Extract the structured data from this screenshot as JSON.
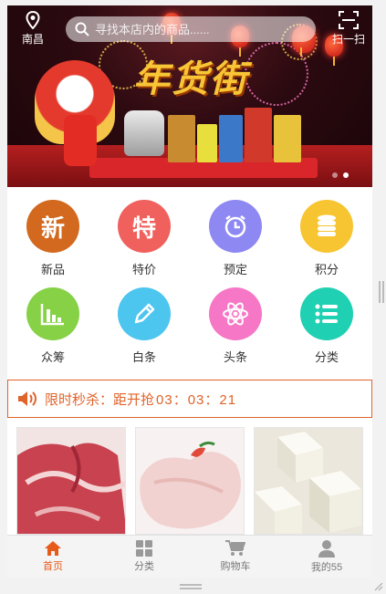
{
  "header": {
    "location": "南昌",
    "search_placeholder": "寻找本店内的商品......",
    "scan_label": "扫一扫"
  },
  "banner": {
    "title": "年货街",
    "slide_count": 2,
    "active_slide": 2
  },
  "categories": [
    {
      "label": "新品",
      "glyph": "新",
      "icon": "new-icon",
      "color": "#d2691e"
    },
    {
      "label": "特价",
      "glyph": "特",
      "icon": "special-price-icon",
      "color": "#f0605d"
    },
    {
      "label": "预定",
      "glyph": "",
      "icon": "alarm-clock-icon",
      "color": "#8e88f2"
    },
    {
      "label": "积分",
      "glyph": "",
      "icon": "coins-icon",
      "color": "#f7c531"
    },
    {
      "label": "众筹",
      "glyph": "",
      "icon": "bar-chart-icon",
      "color": "#86d146"
    },
    {
      "label": "白条",
      "glyph": "",
      "icon": "pencil-icon",
      "color": "#4cc5ef"
    },
    {
      "label": "头条",
      "glyph": "",
      "icon": "atom-icon",
      "color": "#f577c6"
    },
    {
      "label": "分类",
      "glyph": "",
      "icon": "list-icon",
      "color": "#1fd0b2"
    }
  ],
  "flash_sale": {
    "label": "限时秒杀：距开抢",
    "countdown": "03：03：21",
    "icon": "speaker-icon",
    "color": "#e0632a"
  },
  "products": [
    {
      "name": "pork-product",
      "color": "#c8424f"
    },
    {
      "name": "chicken-product",
      "color": "#f1d2d0"
    },
    {
      "name": "tofu-product",
      "color": "#f4f2e6"
    }
  ],
  "tabbar": [
    {
      "label": "首页",
      "icon": "home-icon",
      "active": true
    },
    {
      "label": "分类",
      "icon": "grid-icon",
      "active": false
    },
    {
      "label": "购物车",
      "icon": "cart-icon",
      "active": false
    },
    {
      "label": "我的55",
      "icon": "user-icon",
      "active": false
    }
  ]
}
